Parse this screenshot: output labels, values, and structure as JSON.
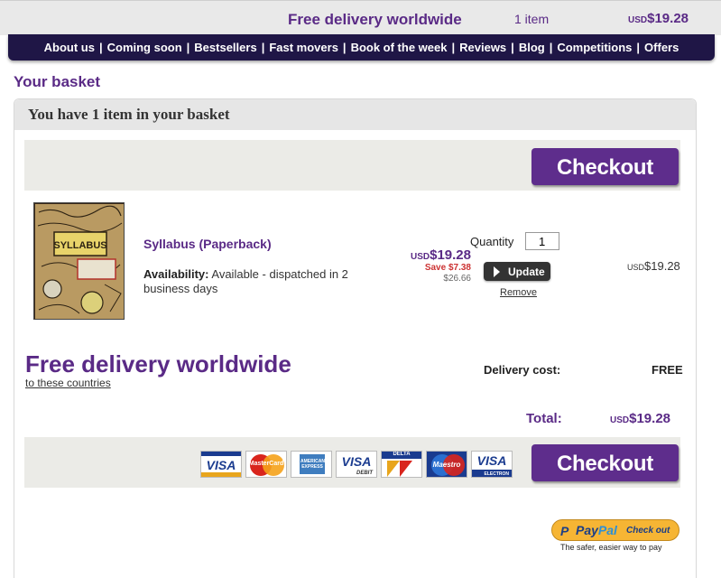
{
  "topbar": {
    "free_delivery": "Free delivery worldwide",
    "items": "1 item",
    "currency": "USD",
    "total": "$19.28"
  },
  "nav": [
    "About us",
    "Coming soon",
    "Bestsellers",
    "Fast movers",
    "Book of the week",
    "Reviews",
    "Blog",
    "Competitions",
    "Offers"
  ],
  "page_title": "Your basket",
  "panel_heading": "You have 1 item in your basket",
  "checkout_label": "Checkout",
  "item": {
    "title": "Syllabus (Paperback)",
    "availability_label": "Availability:",
    "availability_text": "Available - dispatched in 2 business days",
    "currency": "USD",
    "price": "$19.28",
    "save": "Save $7.38",
    "rrp": "$26.66",
    "quantity_label": "Quantity",
    "quantity": "1",
    "update_label": "Update",
    "remove_label": "Remove",
    "line_currency": "USD",
    "line_total": "$19.28",
    "cover_title": "SYLLABUS"
  },
  "delivery": {
    "heading": "Free delivery worldwide",
    "link": "to these countries",
    "cost_label": "Delivery cost:",
    "cost_value": "FREE"
  },
  "total": {
    "label": "Total:",
    "currency": "USD",
    "value": "$19.28"
  },
  "cards": [
    {
      "name": "visa-card-icon",
      "text": "VISA"
    },
    {
      "name": "mastercard-icon",
      "text": "MasterCard"
    },
    {
      "name": "american-express-icon",
      "text": "AMERICAN EXPRESS"
    },
    {
      "name": "visa-debit-icon",
      "text": "VISA",
      "sub": "DEBIT"
    },
    {
      "name": "delta-card-icon",
      "text": "DELTA"
    },
    {
      "name": "maestro-icon",
      "text": "Maestro"
    },
    {
      "name": "visa-electron-icon",
      "text": "VISA",
      "sub": "ELECTRON"
    }
  ],
  "paypal": {
    "pay": "Pay",
    "pal": "Pal",
    "checkout": "Check out",
    "tagline": "The safer, easier way to pay"
  },
  "colors": {
    "brand_purple": "#5e2d8c",
    "nav_bg": "#1f1646",
    "save_red": "#cc3333",
    "paypal_gold": "#f6b534"
  }
}
